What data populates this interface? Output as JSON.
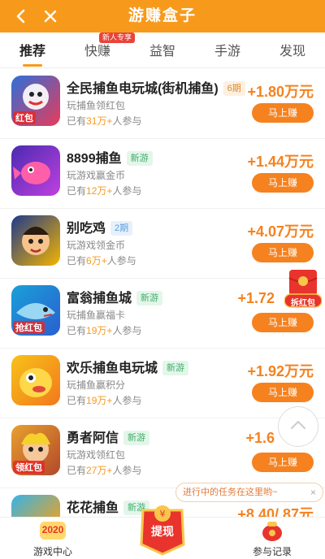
{
  "header": {
    "title": "游赚盒子"
  },
  "tabs": [
    {
      "label": "推荐"
    },
    {
      "label": "快赚",
      "badge": "新人专享"
    },
    {
      "label": "益智"
    },
    {
      "label": "手游"
    },
    {
      "label": "发现"
    }
  ],
  "games": [
    {
      "name": "全民捕鱼电玩城(街机捕鱼)",
      "tag": "6期",
      "desc": "玩捕鱼领红包",
      "count_prefix": "已有",
      "count": "31万+",
      "count_suffix": "人参与",
      "reward": "+1.80万元",
      "button": "马上赚",
      "icon_label": "红包"
    },
    {
      "name": "8899捕鱼",
      "tag": "新游",
      "desc": "玩游戏赢金币",
      "count_prefix": "已有",
      "count": "12万+",
      "count_suffix": "人参与",
      "reward": "+1.44万元",
      "button": "马上赚",
      "icon_label": ""
    },
    {
      "name": "别吃鸡",
      "tag": "2期",
      "desc": "玩游戏领金币",
      "count_prefix": "已有",
      "count": "6万+",
      "count_suffix": "人参与",
      "reward": "+4.07万元",
      "button": "马上赚",
      "icon_label": ""
    },
    {
      "name": "富翁捕鱼城",
      "tag": "新游",
      "desc": "玩捕鱼赢福卡",
      "count_prefix": "已有",
      "count": "19万+",
      "count_suffix": "人参与",
      "reward": "+1.72",
      "button": "马上赚",
      "icon_label": "抢红包"
    },
    {
      "name": "欢乐捕鱼电玩城",
      "tag": "新游",
      "desc": "玩捕鱼赢积分",
      "count_prefix": "已有",
      "count": "19万+",
      "count_suffix": "人参与",
      "reward": "+1.92万元",
      "button": "马上赚",
      "icon_label": ""
    },
    {
      "name": "勇者阿信",
      "tag": "新游",
      "desc": "玩游戏领红包",
      "count_prefix": "已有",
      "count": "27万+",
      "count_suffix": "人参与",
      "reward": "+1.6",
      "button": "马上赚",
      "icon_label": "领红包"
    },
    {
      "name": "花花捕鱼",
      "tag": "新游",
      "desc": "",
      "count_prefix": "",
      "count": "",
      "count_suffix": "",
      "reward": "+8.40/.87元",
      "button": "",
      "icon_label": ""
    }
  ],
  "floating": {
    "hongbao_label": "拆红包",
    "task_tip": "进行中的任务在这里哟~",
    "task_tip_close": "×"
  },
  "bottom_nav": {
    "left_label": "游戏中心",
    "center_label": "提现",
    "right_label": "参与记录",
    "badge_2020": "2020"
  },
  "colors": {
    "primary": "#f79a1c",
    "button": "#f5821f",
    "new_tag": "#3fae6a"
  }
}
